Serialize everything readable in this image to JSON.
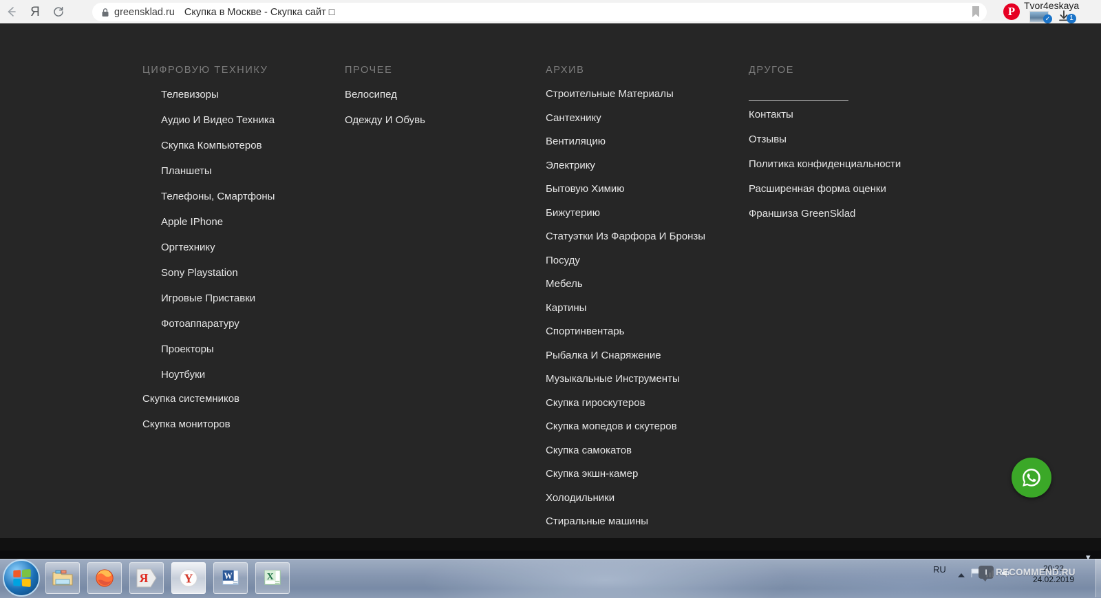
{
  "browser": {
    "back_icon": "back-arrow-icon",
    "yandex_icon": "Я",
    "reload_icon": "reload-icon",
    "lock_icon": "lock-icon",
    "url_host": "greensklad.ru",
    "url_title": "Скупка в Москве - Скупка сайт □",
    "bookmark_icon": "bookmark-icon",
    "pinterest_label": "P",
    "profile_name": "Tvor4eskaya",
    "avatar_check": "✓",
    "download_badge": "1"
  },
  "footer_menu": {
    "columns": [
      {
        "heading": "ЦИФРОВУЮ ТЕХНИКУ",
        "indented_items": [
          "Телевизоры",
          "Аудио И Видео Техника",
          "Скупка Компьютеров",
          "Планшеты",
          "Телефоны, Смартфоны",
          "Apple IPhone",
          "Оргтехнику",
          "Sony Playstation",
          "Игровые Приставки",
          "Фотоаппаратуру",
          "Проекторы",
          "Ноутбуки"
        ],
        "root_items": [
          "Скупка системников",
          "Скупка мониторов"
        ]
      },
      {
        "heading": "ПРОЧЕЕ",
        "indented_items": [],
        "root_items": [
          "Велосипед",
          "Одежду И Обувь"
        ]
      },
      {
        "heading": "АРХИВ",
        "indented_items": [],
        "root_items": [
          "Строительные Материалы",
          "Сантехнику",
          "Вентиляцию",
          "Электрику",
          "Бытовую Химию",
          "Бижутерию",
          "Статуэтки Из Фарфора И Бронзы",
          "Посуду",
          "Мебель",
          "Картины",
          "Спортинвентарь",
          "Рыбалка И Снаряжение",
          "Музыкальные Инструменты",
          "Скупка гироскутеров",
          "Скупка мопедов и скутеров",
          "Скупка самокатов",
          "Скупка экшн-камер",
          "Холодильники",
          "Стиральные машины"
        ]
      },
      {
        "heading": "ДРУГОЕ",
        "indented_items": [],
        "root_items": [
          "Контакты",
          "Отзывы",
          "Политика конфиденциальности",
          "Расширенная форма оценки",
          "Франшиза GreenSklad"
        ]
      }
    ]
  },
  "floating_action": {
    "name": "whatsapp-button",
    "color": "#3ba828"
  },
  "taskbar": {
    "start_label": "start-orb",
    "items": [
      "file-explorer",
      "firefox",
      "yandex-browser",
      "yandex-search",
      "microsoft-word",
      "microsoft-excel"
    ],
    "tray": {
      "language": "RU",
      "time": "20:23",
      "date": "24.02.2019"
    }
  },
  "watermark": {
    "logo": "I",
    "text": "RECOMMEND.RU"
  },
  "colors": {
    "page_bg": "#262626",
    "footer_strip": "#111111",
    "heading": "#7d7d7d",
    "link": "#e6e6e6",
    "whatsapp": "#3ba828",
    "badge_blue": "#1a73c8"
  }
}
